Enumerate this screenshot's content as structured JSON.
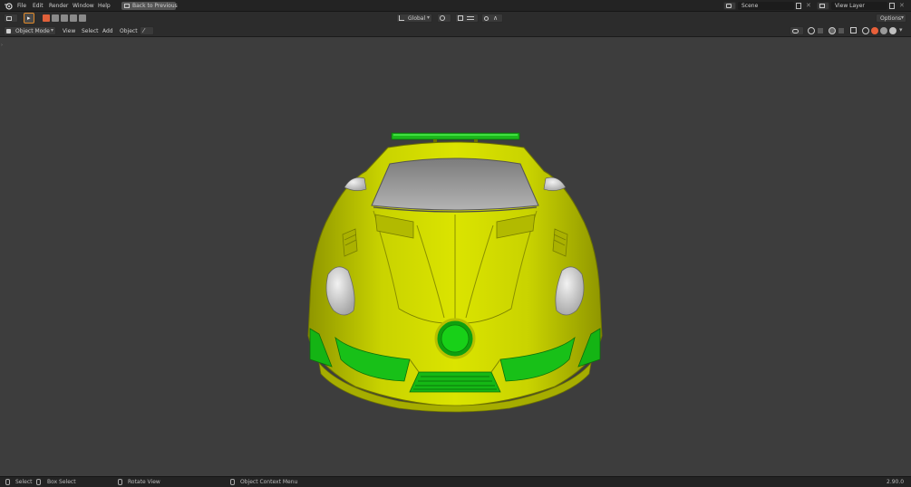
{
  "topbar": {
    "menus": [
      "File",
      "Edit",
      "Render",
      "Window",
      "Help"
    ],
    "back_button": "Back to Previous",
    "scene_label": "Scene",
    "view_layer_label": "View Layer"
  },
  "toolbar": {
    "orientation": "Global",
    "options_label": "Options"
  },
  "header": {
    "mode": "Object Mode",
    "menus": [
      "View",
      "Select",
      "Add",
      "Object"
    ]
  },
  "statusbar": {
    "select": "Select",
    "box_select": "Box Select",
    "rotate_view": "Rotate View",
    "context_menu": "Object Context Menu",
    "version": "2.90.0"
  },
  "colors": {
    "body": "#c6d000",
    "accent_green": "#18c618",
    "glass": "#9a9a9a",
    "viewport_bg": "#3d3d3d"
  }
}
